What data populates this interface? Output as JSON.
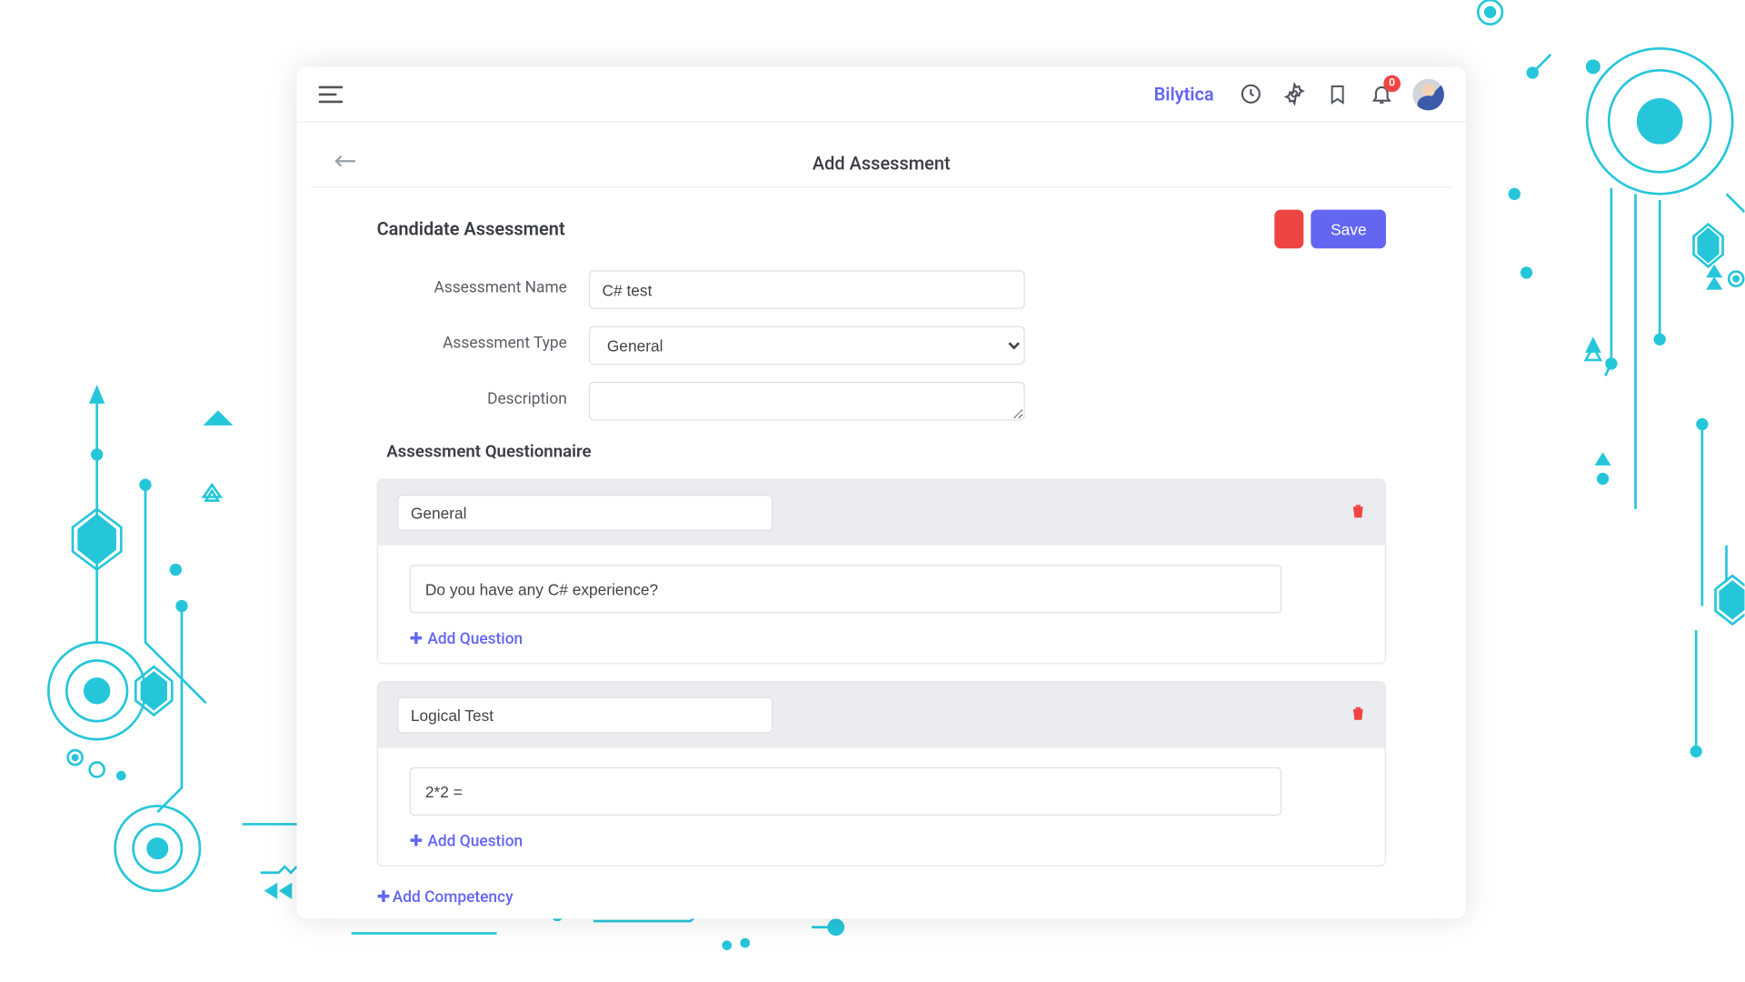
{
  "header": {
    "brand": "Bilytica",
    "notifications_count": "0"
  },
  "page": {
    "title": "Add Assessment"
  },
  "form": {
    "section_title": "Candidate Assessment",
    "save_label": "Save",
    "labels": {
      "name": "Assessment Name",
      "type": "Assessment Type",
      "description": "Description"
    },
    "values": {
      "name": "C# test",
      "type": "General",
      "description": ""
    },
    "type_options": [
      "General"
    ]
  },
  "questionnaire": {
    "title": "Assessment Questionnaire",
    "add_question_label": "Add Question",
    "add_competency_label": "Add Competency",
    "competencies": [
      {
        "name": "General",
        "questions": [
          "Do you have any C# experience?"
        ]
      },
      {
        "name": "Logical Test",
        "questions": [
          "2*2 ="
        ]
      }
    ]
  }
}
